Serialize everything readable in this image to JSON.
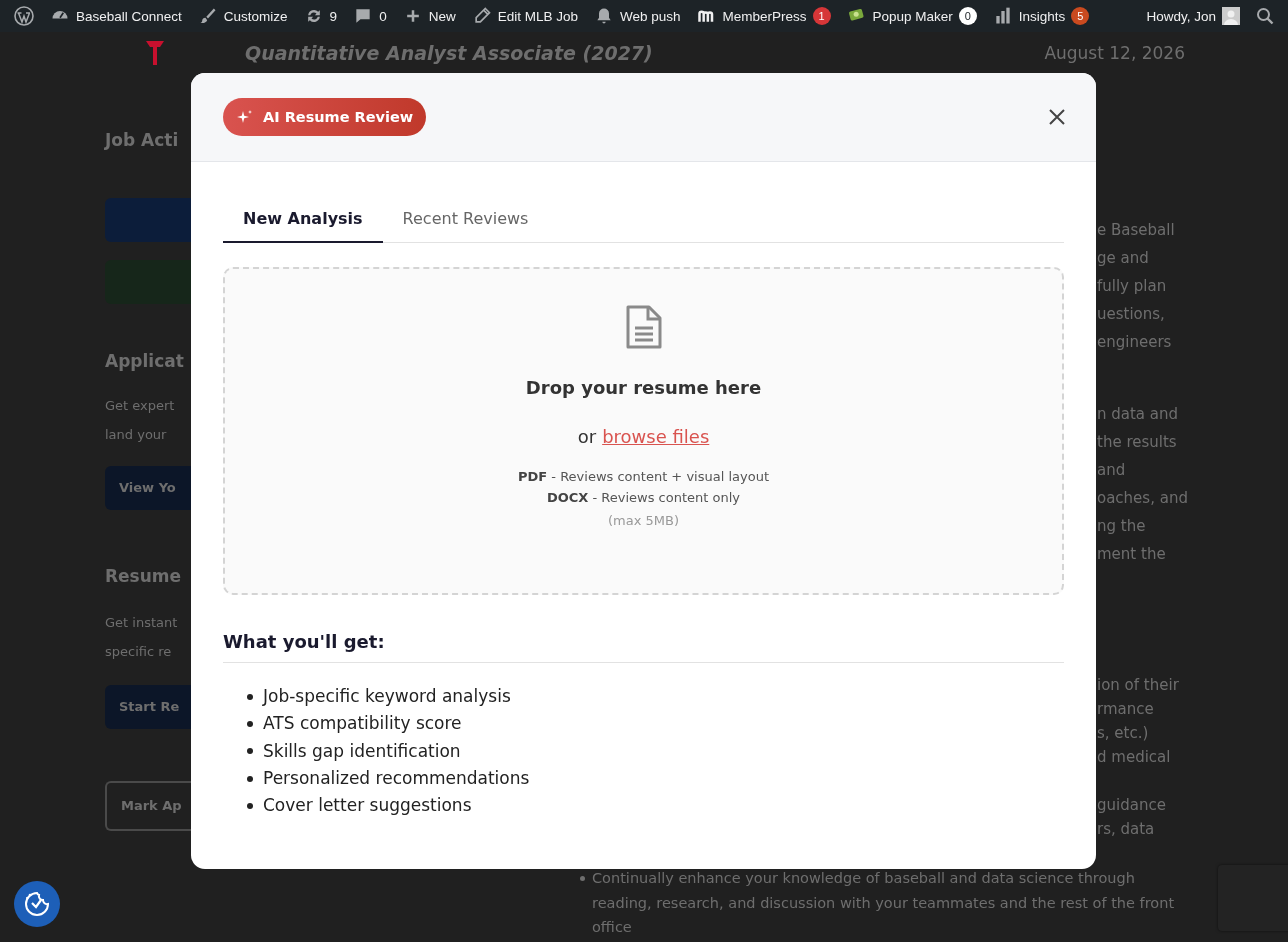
{
  "admin_bar": {
    "items": [
      {
        "label": "Baseball Connect"
      },
      {
        "label": "Customize"
      },
      {
        "label": "9"
      },
      {
        "label": "0"
      },
      {
        "label": "New"
      },
      {
        "label": "Edit MLB Job"
      },
      {
        "label": "Web push"
      },
      {
        "label": "MemberPress",
        "badge": {
          "text": "1",
          "color": "#d63638"
        }
      },
      {
        "label": "Popup Maker",
        "badge": {
          "text": "0",
          "color": "#ffffff"
        }
      },
      {
        "label": "Insights",
        "badge": {
          "text": "5",
          "color": "#ca4a1f"
        }
      }
    ],
    "account": "Howdy, Jon"
  },
  "background_page": {
    "job_title": "Quantitative Analyst Associate (2027)",
    "date": "August 12, 2026",
    "sidebar": [
      {
        "kind": "heading",
        "text": "Job Acti"
      },
      {
        "kind": "button",
        "color": "#0c1d3a"
      },
      {
        "kind": "button",
        "color": "#16261a"
      },
      {
        "kind": "heading",
        "text": "Applicat"
      },
      {
        "kind": "text",
        "text": "Get expert"
      },
      {
        "kind": "text",
        "text": "land your"
      },
      {
        "kind": "button",
        "text": "View Yo",
        "color": "#0c1628"
      },
      {
        "kind": "heading",
        "text": "Resume"
      },
      {
        "kind": "text",
        "text": "Get instant"
      },
      {
        "kind": "text",
        "text": "specific re"
      },
      {
        "kind": "button",
        "text": "Start Re",
        "color": "#0c1628"
      },
      {
        "kind": "outline_button",
        "text": "Mark Ap"
      }
    ],
    "description_fragments": [
      [
        "e Baseball",
        "ge and",
        "fully plan",
        "uestions,",
        "engineers"
      ],
      [
        "n data and",
        "the results",
        "and",
        "oaches, and",
        "ng the",
        "ment the"
      ],
      [
        "ion of their",
        "rmance",
        "s, etc.)",
        "d medical"
      ],
      [
        "guidance",
        "rs, data"
      ]
    ],
    "bullet": "Continually enhance your knowledge of baseball and data science through reading, research, and discussion with your teammates and the rest of the front office"
  },
  "modal": {
    "badge": "AI Resume Review",
    "tabs": [
      {
        "label": "New Analysis",
        "selected": true
      },
      {
        "label": "Recent Reviews",
        "selected": false
      }
    ],
    "dropzone": {
      "title": "Drop your resume here",
      "browse_prefix": "or",
      "browse_link": "browse files",
      "formats": [
        "**PDF** - Reviews content + visual layout",
        "**DOCX** - Reviews content only"
      ],
      "limit": "(max 5MB)"
    },
    "benefits_title": "What you'll get:",
    "benefits": [
      "Job-specific keyword analysis",
      "ATS compatibility score",
      "Skills gap identification",
      "Personalized recommendations",
      "Cover letter suggestions"
    ]
  }
}
